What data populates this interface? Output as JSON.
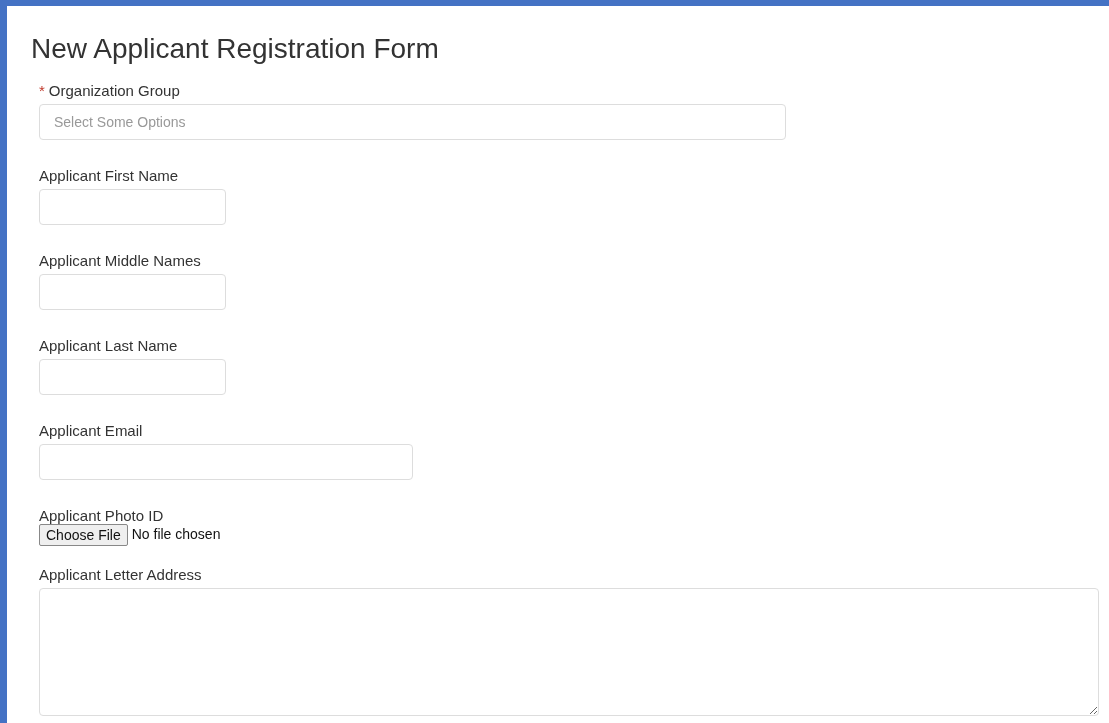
{
  "title": "New Applicant Registration Form",
  "fields": [
    {
      "kind": "select",
      "label": "Organization Group",
      "required_mark": "*",
      "placeholder": "Select Some Options"
    },
    {
      "kind": "text",
      "label": "Applicant First Name"
    },
    {
      "kind": "text",
      "label": "Applicant Middle Names"
    },
    {
      "kind": "text",
      "label": "Applicant Last Name"
    },
    {
      "kind": "email",
      "label": "Applicant Email"
    },
    {
      "kind": "file",
      "label": "Applicant Photo ID",
      "button": "Choose File",
      "status": "No file chosen"
    },
    {
      "kind": "textarea",
      "label": "Applicant Letter Address"
    }
  ]
}
